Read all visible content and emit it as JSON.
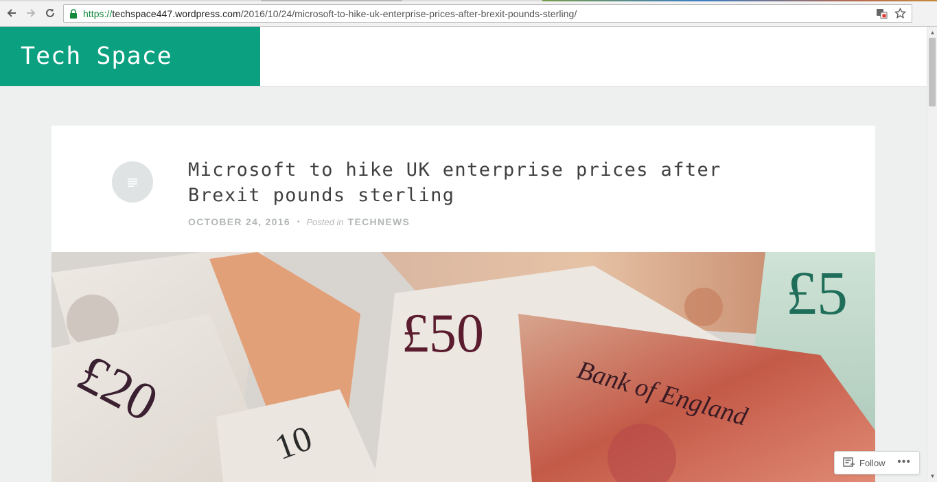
{
  "browser": {
    "url_scheme": "https://",
    "url_host": "techspace447.wordpress.com",
    "url_path": "/2016/10/24/microsoft-to-hike-uk-enterprise-prices-after-brexit-pounds-sterling/"
  },
  "site": {
    "title": "Tech Space",
    "brand_color": "#0aa080"
  },
  "post": {
    "title": "Microsoft to hike UK enterprise prices after Brexit pounds sterling",
    "date": "October 24, 2016",
    "separator": "•",
    "posted_in_label": "Posted in",
    "category": "Technews",
    "format_icon": "text-lines-icon",
    "featured_image": "pound-sterling-banknotes"
  },
  "follow_widget": {
    "label": "Follow",
    "more_label": "•••"
  }
}
